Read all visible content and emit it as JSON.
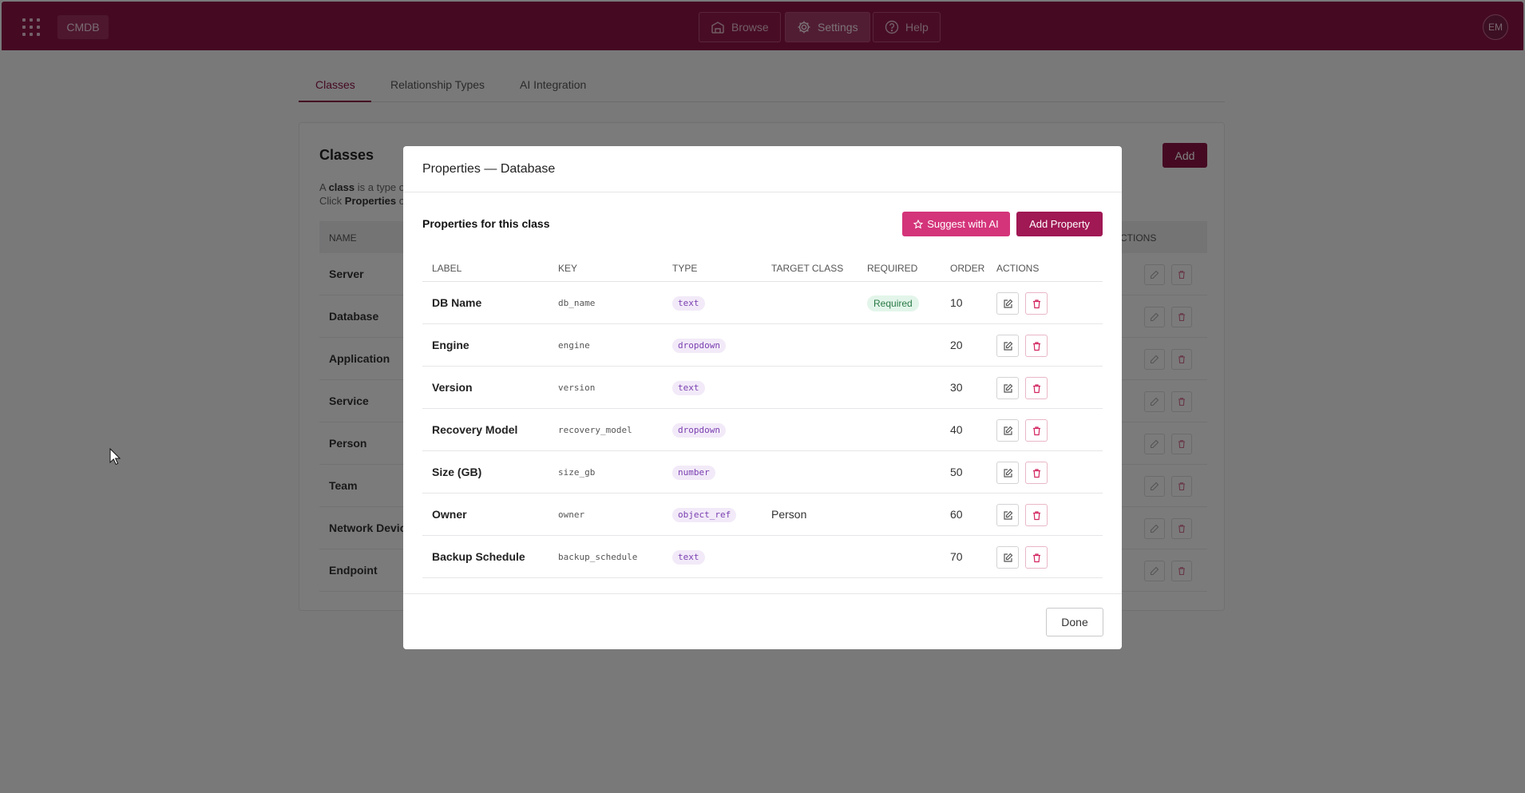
{
  "topbar": {
    "brand": "CMDB",
    "nav": [
      {
        "label": "Browse",
        "icon": "building-icon",
        "active": false
      },
      {
        "label": "Settings",
        "icon": "gear-icon",
        "active": true
      },
      {
        "label": "Help",
        "icon": "question-icon",
        "active": false
      }
    ],
    "avatar_initials": "EM"
  },
  "tabs": [
    {
      "label": "Classes",
      "active": true
    },
    {
      "label": "Relationship Types",
      "active": false
    },
    {
      "label": "AI Integration",
      "active": false
    }
  ],
  "classes_card": {
    "title": "Classes",
    "desc_line1_pre": "A ",
    "desc_line1_bold": "class",
    "desc_line1_post": " is a type of",
    "desc_line2_pre": "Click ",
    "desc_line2_bold": "Properties",
    "desc_line2_post": " o",
    "add_label": "Add",
    "col_name": "NAME",
    "col_actions": "CTIONS",
    "rows": [
      "Server",
      "Database",
      "Application",
      "Service",
      "Person",
      "Team",
      "Network Devic",
      "Endpoint"
    ]
  },
  "modal": {
    "title": "Properties — Database",
    "section_title": "Properties for this class",
    "suggest_label": "Suggest with AI",
    "add_property_label": "Add Property",
    "columns": {
      "label": "LABEL",
      "key": "KEY",
      "type": "TYPE",
      "target_class": "TARGET CLASS",
      "required": "REQUIRED",
      "order": "ORDER",
      "actions": "ACTIONS"
    },
    "properties": [
      {
        "label": "DB Name",
        "key": "db_name",
        "type": "text",
        "target_class": "",
        "required": "Required",
        "order": "10"
      },
      {
        "label": "Engine",
        "key": "engine",
        "type": "dropdown",
        "target_class": "",
        "required": "",
        "order": "20"
      },
      {
        "label": "Version",
        "key": "version",
        "type": "text",
        "target_class": "",
        "required": "",
        "order": "30"
      },
      {
        "label": "Recovery Model",
        "key": "recovery_model",
        "type": "dropdown",
        "target_class": "",
        "required": "",
        "order": "40"
      },
      {
        "label": "Size (GB)",
        "key": "size_gb",
        "type": "number",
        "target_class": "",
        "required": "",
        "order": "50"
      },
      {
        "label": "Owner",
        "key": "owner",
        "type": "object_ref",
        "target_class": "Person",
        "required": "",
        "order": "60"
      },
      {
        "label": "Backup Schedule",
        "key": "backup_schedule",
        "type": "text",
        "target_class": "",
        "required": "",
        "order": "70"
      }
    ],
    "done_label": "Done"
  },
  "colors": {
    "brand": "#8a1444",
    "accent_pink": "#d4347a",
    "type_badge": "#7a3fb0",
    "required_badge": "#2a7a46"
  }
}
